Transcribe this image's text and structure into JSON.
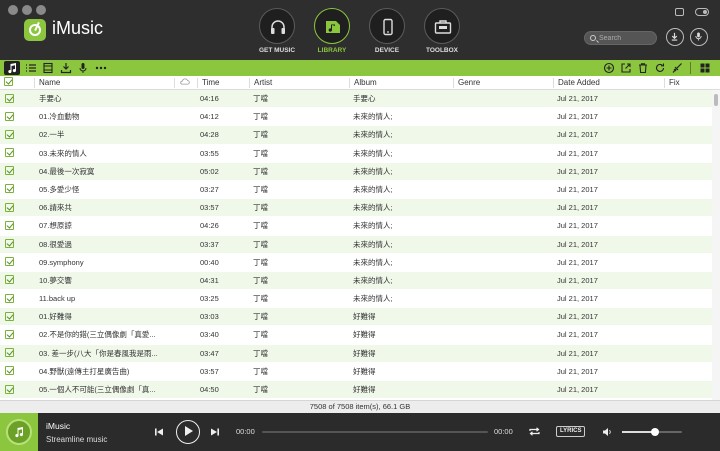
{
  "app": {
    "name": "iMusic"
  },
  "colors": {
    "accent": "#8cc63f",
    "header_bg": "#2e2e2e",
    "row_alt": "#f0f8ea"
  },
  "nav": [
    {
      "label": "GET MUSIC",
      "icon": "headphones-icon",
      "active": false
    },
    {
      "label": "LIBRARY",
      "icon": "library-music-icon",
      "active": true
    },
    {
      "label": "DEVICE",
      "icon": "phone-icon",
      "active": false
    },
    {
      "label": "TOOLBOX",
      "icon": "toolbox-icon",
      "active": false
    }
  ],
  "search": {
    "placeholder": "Search",
    "value": ""
  },
  "table": {
    "columns": [
      "Name",
      "Time",
      "Artist",
      "Album",
      "Genre",
      "Date Added",
      "Fix"
    ],
    "rows": [
      {
        "name": "手要心",
        "time": "04:16",
        "artist": "丁噹",
        "album": "手要心",
        "genre": "",
        "date": "Jul 21, 2017",
        "fix": ""
      },
      {
        "name": "01.冷血動物",
        "time": "04:12",
        "artist": "丁噹",
        "album": "未來的情人;",
        "genre": "",
        "date": "Jul 21, 2017",
        "fix": ""
      },
      {
        "name": "02.一半",
        "time": "04:28",
        "artist": "丁噹",
        "album": "未來的情人;",
        "genre": "",
        "date": "Jul 21, 2017",
        "fix": ""
      },
      {
        "name": "03.未來的情人",
        "time": "03:55",
        "artist": "丁噹",
        "album": "未來的情人;",
        "genre": "",
        "date": "Jul 21, 2017",
        "fix": ""
      },
      {
        "name": "04.最後一次寂寞",
        "time": "05:02",
        "artist": "丁噹",
        "album": "未來的情人;",
        "genre": "",
        "date": "Jul 21, 2017",
        "fix": ""
      },
      {
        "name": "05.多愛少怪",
        "time": "03:27",
        "artist": "丁噹",
        "album": "未來的情人;",
        "genre": "",
        "date": "Jul 21, 2017",
        "fix": ""
      },
      {
        "name": "06.請來共",
        "time": "03:57",
        "artist": "丁噹",
        "album": "未來的情人;",
        "genre": "",
        "date": "Jul 21, 2017",
        "fix": ""
      },
      {
        "name": "07.想原諒",
        "time": "04:26",
        "artist": "丁噹",
        "album": "未來的情人;",
        "genre": "",
        "date": "Jul 21, 2017",
        "fix": ""
      },
      {
        "name": "08.很愛過",
        "time": "03:37",
        "artist": "丁噹",
        "album": "未來的情人;",
        "genre": "",
        "date": "Jul 21, 2017",
        "fix": ""
      },
      {
        "name": "09.symphony",
        "time": "00:40",
        "artist": "丁噹",
        "album": "未來的情人;",
        "genre": "",
        "date": "Jul 21, 2017",
        "fix": ""
      },
      {
        "name": "10.夢交響",
        "time": "04:31",
        "artist": "丁噹",
        "album": "未來的情人;",
        "genre": "",
        "date": "Jul 21, 2017",
        "fix": ""
      },
      {
        "name": "11.back up",
        "time": "03:25",
        "artist": "丁噹",
        "album": "未來的情人;",
        "genre": "",
        "date": "Jul 21, 2017",
        "fix": ""
      },
      {
        "name": "01.好難得",
        "time": "03:03",
        "artist": "丁噹",
        "album": "好難得",
        "genre": "",
        "date": "Jul 21, 2017",
        "fix": ""
      },
      {
        "name": "02.不是你的錯(三立偶像劇「真愛...",
        "time": "03:40",
        "artist": "丁噹",
        "album": "好難得",
        "genre": "",
        "date": "Jul 21, 2017",
        "fix": ""
      },
      {
        "name": "03. 差一步(八大「你是春風我是雨...",
        "time": "03:47",
        "artist": "丁噹",
        "album": "好難得",
        "genre": "",
        "date": "Jul 21, 2017",
        "fix": ""
      },
      {
        "name": "04.野獸(遠傳主打星廣告曲)",
        "time": "03:57",
        "artist": "丁噹",
        "album": "好難得",
        "genre": "",
        "date": "Jul 21, 2017",
        "fix": ""
      },
      {
        "name": "05.一個人不可能(三立偶像劇「真...",
        "time": "04:50",
        "artist": "丁噹",
        "album": "好難得",
        "genre": "",
        "date": "Jul 21, 2017",
        "fix": ""
      }
    ]
  },
  "status": {
    "text": "7508 of 7508 item(s), 66.1 GB"
  },
  "player": {
    "title": "iMusic",
    "subtitle": "Streamline music",
    "elapsed": "00:00",
    "total": "00:00",
    "progress": 0,
    "lyrics_label": "LYRICS",
    "volume": 0.55
  }
}
